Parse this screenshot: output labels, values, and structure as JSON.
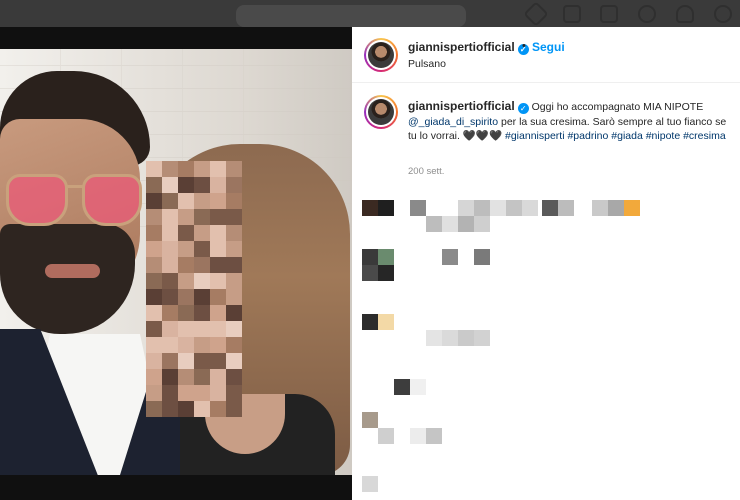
{
  "post": {
    "username": "giannispertiofficial",
    "follow_label": "Segui",
    "separator": "•",
    "location": "Pulsano",
    "caption": {
      "text_before_mention": "Oggi ho accompagnato MIA NIPOTE",
      "mention": "@_giada_di_spirito",
      "text_after_mention": "per la sua cresima. Sarò sempre al tuo fianco se tu lo vorrai. 🖤🖤🖤",
      "hashtags": [
        "#giannisperti",
        "#padrino",
        "#giada",
        "#nipote",
        "#cresima"
      ]
    },
    "timestamp": "200 sett."
  },
  "colors": {
    "accent": "#0095f6",
    "link": "#00376b",
    "muted": "#8e8e8e",
    "text": "#262626"
  },
  "icons": [
    "verified-badge-icon",
    "home-icon",
    "messenger-icon",
    "new-post-icon",
    "explore-icon",
    "heart-icon"
  ]
}
